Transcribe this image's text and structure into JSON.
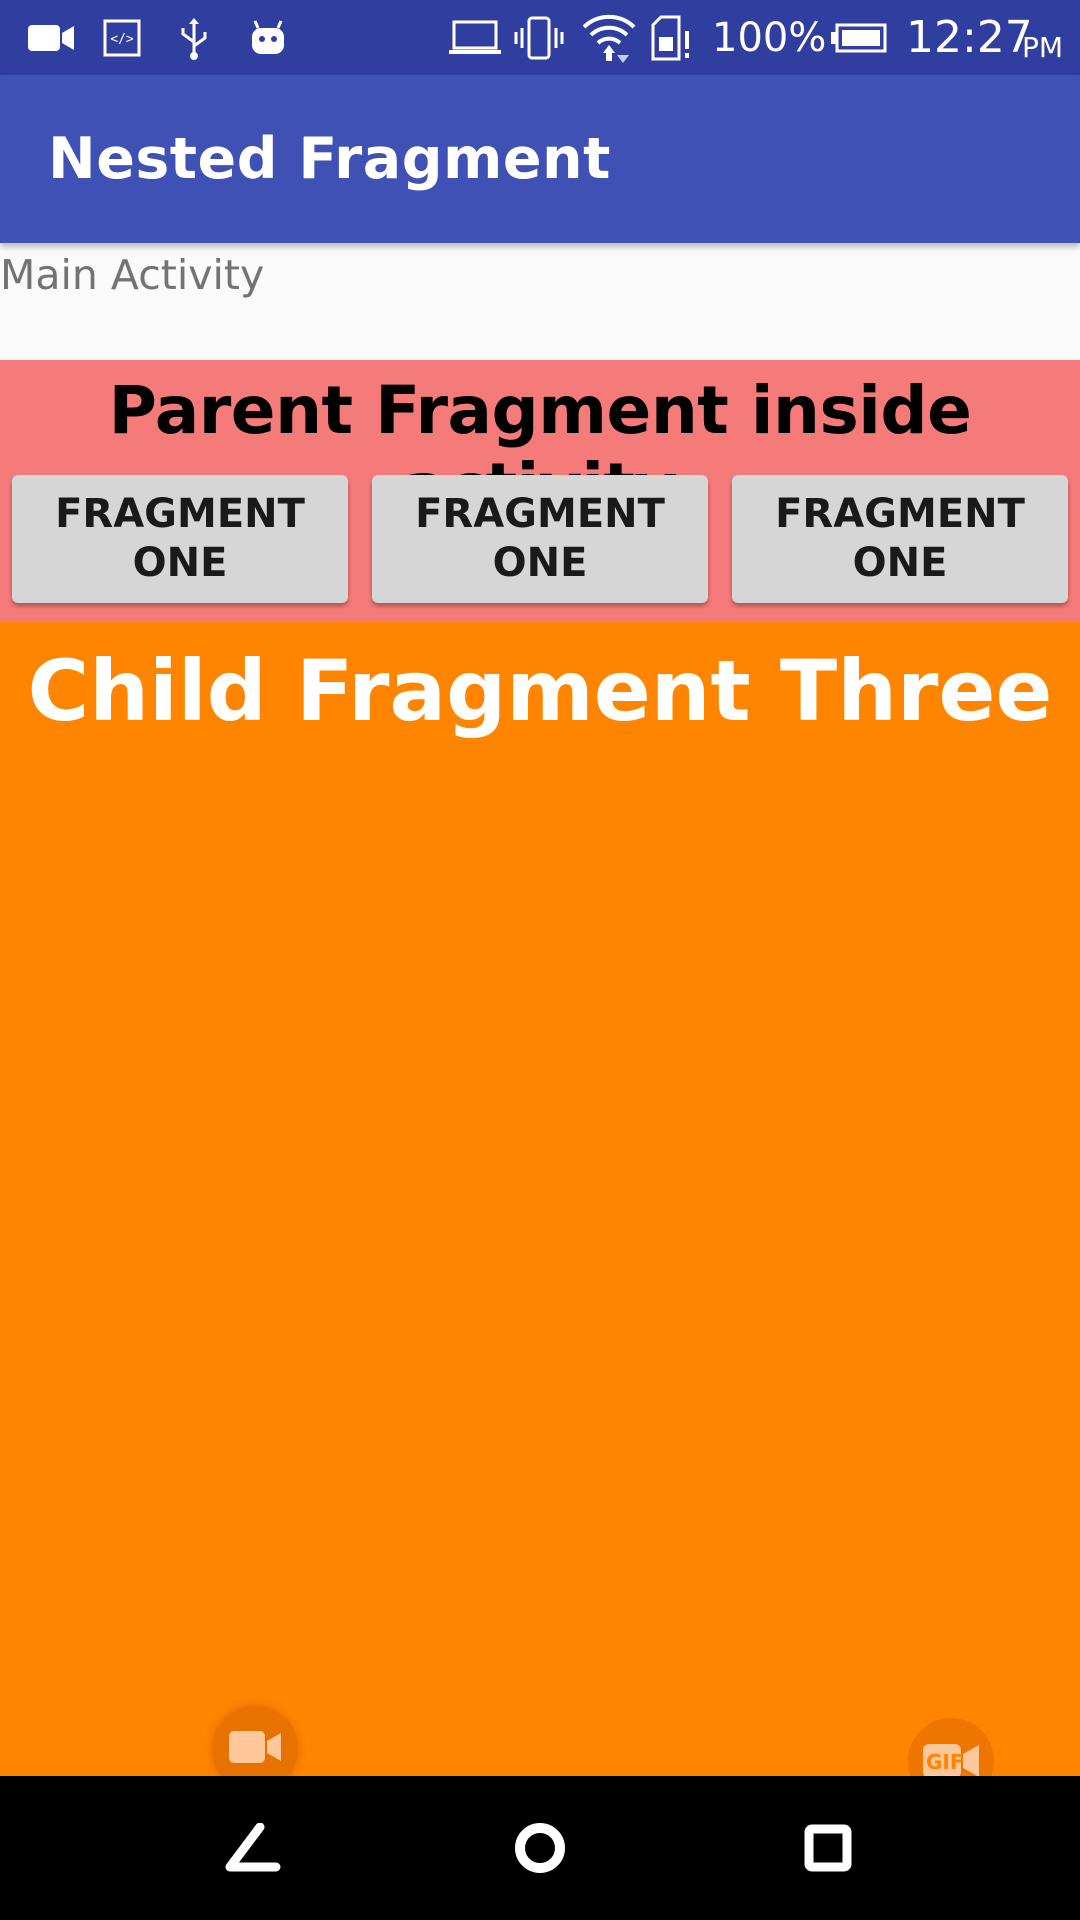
{
  "status_bar": {
    "battery_percent": "100%",
    "time": "12:27",
    "am_pm": "PM",
    "left_icons": [
      "video-camera-icon",
      "code-icon",
      "usb-icon",
      "android-icon"
    ],
    "right_icons": [
      "laptop-icon",
      "vibrate-icon",
      "wifi-icon",
      "sd-card-icon",
      "battery-icon"
    ]
  },
  "app_bar": {
    "title": "Nested Fragment"
  },
  "activity": {
    "label": "Main Activity"
  },
  "parent_fragment": {
    "title": "Parent Fragment inside activity",
    "buttons": [
      {
        "label": "FRAGMENT ONE"
      },
      {
        "label": "FRAGMENT ONE"
      },
      {
        "label": "FRAGMENT ONE"
      }
    ]
  },
  "child_fragment": {
    "title": "Child Fragment Three"
  },
  "overlay": {
    "gif_label": "GIF"
  },
  "nav_bar": {
    "icons": [
      "back-icon",
      "home-icon",
      "recents-icon"
    ]
  },
  "colors": {
    "status_bar": "#303f9f",
    "app_bar": "#3f51b5",
    "parent_fragment": "#f57a7a",
    "child_fragment": "#ff8400",
    "button": "#d6d6d6"
  }
}
